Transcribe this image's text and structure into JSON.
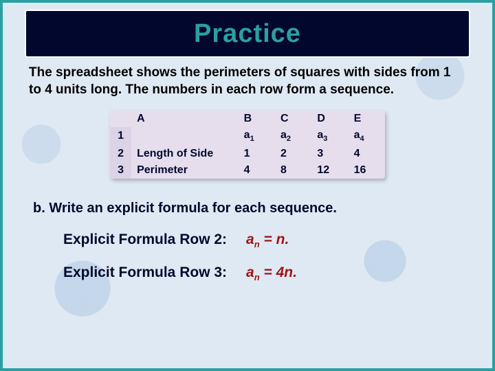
{
  "title": "Practice",
  "intro": "The spreadsheet shows the perimeters of squares with sides from 1 to 4 units long. The numbers in each row form a sequence.",
  "sheet": {
    "col_headers": {
      "A": "A",
      "B": "B",
      "C": "C",
      "D": "D",
      "E": "E"
    },
    "row_indices": [
      "1",
      "2",
      "3"
    ],
    "row1": {
      "A": "",
      "B": {
        "base": "a",
        "sub": "1"
      },
      "C": {
        "base": "a",
        "sub": "2"
      },
      "D": {
        "base": "a",
        "sub": "3"
      },
      "E": {
        "base": "a",
        "sub": "4"
      }
    },
    "row2": {
      "A": "Length of Side",
      "B": "1",
      "C": "2",
      "D": "3",
      "E": "4"
    },
    "row3": {
      "A": "Perimeter",
      "B": "4",
      "C": "8",
      "D": "12",
      "E": "16"
    }
  },
  "question": "b.  Write an explicit formula for each sequence.",
  "formulas": {
    "row2": {
      "label": "Explicit Formula Row 2:",
      "lhs_base": "a",
      "lhs_sub": "n",
      "rhs": " = n."
    },
    "row3": {
      "label": "Explicit Formula Row 3:",
      "lhs_base": "a",
      "lhs_sub": "n",
      "rhs": " = 4n."
    }
  }
}
